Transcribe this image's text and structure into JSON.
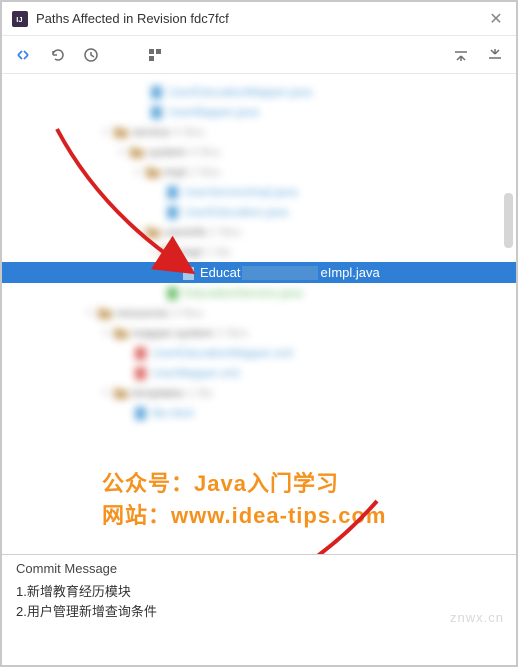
{
  "titlebar": {
    "title": "Paths Affected in Revision fdc7fcf"
  },
  "toolbar": {
    "compare": "compare-icon",
    "undo": "undo-icon",
    "history": "history-icon",
    "group": "group-icon",
    "expand": "expand-icon",
    "collapse": "collapse-icon"
  },
  "tree": {
    "selected": {
      "prefix": "Educat",
      "suffix": "eImpl.java"
    }
  },
  "overlay": {
    "line1": "公众号：Java入门学习",
    "line2": "网站：www.idea-tips.com"
  },
  "commit": {
    "header": "Commit Message",
    "line1": "1.新增教育经历模块",
    "line2": "2.用户管理新增查询条件"
  },
  "watermark": "znwx.cn"
}
